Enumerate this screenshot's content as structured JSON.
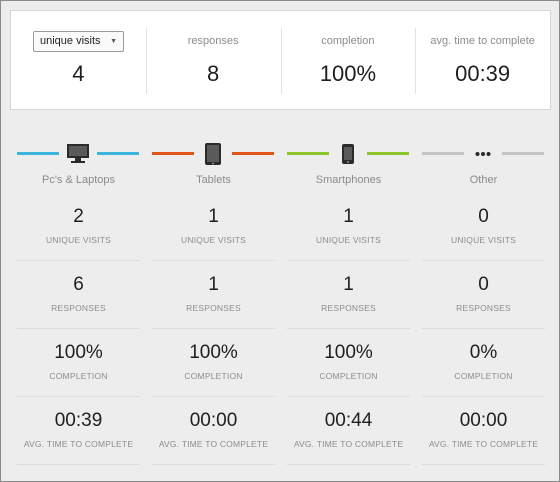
{
  "summary": {
    "metric_select": {
      "selected": "unique visits",
      "caret": "▼"
    },
    "unique_visits": {
      "value": "4"
    },
    "responses": {
      "label": "responses",
      "value": "8"
    },
    "completion": {
      "label": "completion",
      "value": "100%"
    },
    "avg_time": {
      "label": "avg. time to complete",
      "value": "00:39"
    }
  },
  "stat_labels": {
    "unique_visits": "UNIQUE VISITS",
    "responses": "RESPONSES",
    "completion": "COMPLETION",
    "avg_time": "AVG. TIME TO COMPLETE"
  },
  "devices": [
    {
      "name": "Pc's & Laptops",
      "icon": "desktop-icon",
      "color": "#3db4dc",
      "unique_visits": "2",
      "responses": "6",
      "completion": "100%",
      "avg_time": "00:39"
    },
    {
      "name": "Tablets",
      "icon": "tablet-icon",
      "color": "#e0531a",
      "unique_visits": "1",
      "responses": "1",
      "completion": "100%",
      "avg_time": "00:00"
    },
    {
      "name": "Smartphones",
      "icon": "smartphone-icon",
      "color": "#8dc62a",
      "unique_visits": "1",
      "responses": "1",
      "completion": "100%",
      "avg_time": "00:44"
    },
    {
      "name": "Other",
      "icon": "more-dots-icon",
      "color": "#c4c4c4",
      "unique_visits": "0",
      "responses": "0",
      "completion": "0%",
      "avg_time": "00:00"
    }
  ]
}
